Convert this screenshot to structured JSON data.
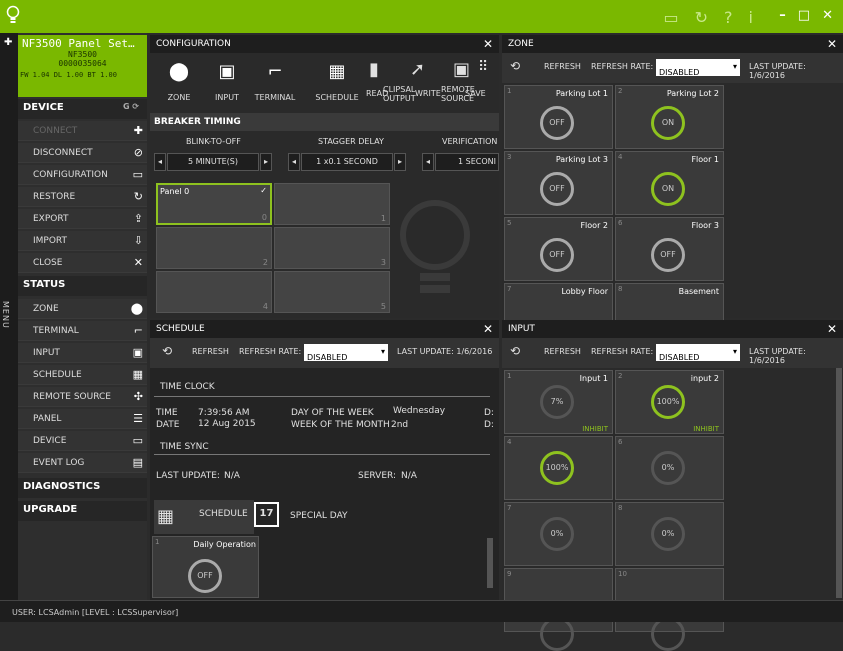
{
  "app": {
    "user_status": "USER: LCSAdmin [LEVEL : LCSSupervisor]"
  },
  "lcd": {
    "line1": "NF3500 Panel Set…",
    "line2": "NF3500",
    "line3": "0000035064",
    "line4": "FW 1.04  DL 1.00  BT 1.00"
  },
  "nav": {
    "device_label": "DEVICE",
    "device_items": [
      "CONNECT",
      "DISCONNECT",
      "CONFIGURATION",
      "RESTORE",
      "EXPORT",
      "IMPORT",
      "CLOSE"
    ],
    "status_label": "STATUS",
    "status_items": [
      "ZONE",
      "TERMINAL",
      "INPUT",
      "SCHEDULE",
      "REMOTE SOURCE",
      "PANEL",
      "DEVICE",
      "EVENT LOG"
    ],
    "diagnostics_label": "DIAGNOSTICS",
    "upgrade_label": "UPGRADE",
    "menu_label": "MENU"
  },
  "config": {
    "title": "CONFIGURATION",
    "tools": [
      "ZONE",
      "INPUT",
      "TERMINAL",
      "SCHEDULE"
    ],
    "tools2": [
      "CLIPSAL OUTPUT",
      "WRITE",
      "REMOTE SOURCE",
      "READ",
      "SAVE"
    ],
    "breaker_timing": "BREAKER TIMING",
    "blink_label": "BLINK-TO-OFF",
    "stagger_label": "STAGGER DELAY",
    "verification_label": "VERIFICATION",
    "blink_value": "5 MINUTE(S)",
    "stagger_value": "1 x0.1 SECOND",
    "verification_value": "1 SECONI",
    "panel_name": "Panel 0",
    "tile_nums": [
      "0",
      "1",
      "2",
      "3",
      "4",
      "5"
    ]
  },
  "zone": {
    "title": "ZONE",
    "refresh": "REFRESH",
    "refresh_rate_label": "REFRESH RATE:",
    "refresh_rate": "DISABLED",
    "last_update": "LAST UPDATE: 1/6/2016",
    "tiles": [
      {
        "idx": "1",
        "name": "Parking Lot 1",
        "state": "OFF"
      },
      {
        "idx": "2",
        "name": "Parking Lot 2",
        "state": "ON"
      },
      {
        "idx": "3",
        "name": "Parking Lot 3",
        "state": "OFF"
      },
      {
        "idx": "4",
        "name": "Floor 1",
        "state": "ON"
      },
      {
        "idx": "5",
        "name": "Floor 2",
        "state": "OFF"
      },
      {
        "idx": "6",
        "name": "Floor 3",
        "state": "OFF"
      },
      {
        "idx": "7",
        "name": "Lobby Floor",
        "state": ""
      },
      {
        "idx": "8",
        "name": "Basement",
        "state": ""
      }
    ]
  },
  "schedule": {
    "title": "SCHEDULE",
    "refresh": "REFRESH",
    "refresh_rate_label": "REFRESH RATE:",
    "refresh_rate": "DISABLED",
    "last_update": "LAST UPDATE: 1/6/2016",
    "time_clock": "TIME CLOCK",
    "time_label": "TIME",
    "time_value": "7:39:56 AM",
    "date_label": "DATE",
    "date_value": "12 Aug 2015",
    "dow_label": "DAY OF THE WEEK",
    "dow_value": "Wednesday",
    "wom_label": "WEEK OF THE MONTH",
    "wom_value": "2nd",
    "d_label1": "D:",
    "d_label2": "D:",
    "time_sync": "TIME SYNC",
    "last_update_sync": "LAST UPDATE:",
    "last_update_sync_value": "N/A",
    "server_label": "SERVER:",
    "server_value": "N/A",
    "schedule_tab": "SCHEDULE",
    "special_day_tab": "SPECIAL DAY",
    "special_day_icon": "17",
    "tile_idx": "1",
    "tile_name": "Daily Operation",
    "tile_state": "OFF"
  },
  "input": {
    "title": "INPUT",
    "refresh": "REFRESH",
    "refresh_rate_label": "REFRESH RATE:",
    "refresh_rate": "DISABLED",
    "last_update": "LAST UPDATE: 1/6/2016",
    "tiles": [
      {
        "idx": "1",
        "name": "Input 1",
        "value": "7%",
        "badge": "INHIBIT"
      },
      {
        "idx": "2",
        "name": "input 2",
        "value": "100%",
        "badge": "INHIBIT"
      },
      {
        "idx": "4",
        "name": "",
        "value": "100%",
        "badge": ""
      },
      {
        "idx": "6",
        "name": "",
        "value": "0%",
        "badge": ""
      },
      {
        "idx": "7",
        "name": "",
        "value": "0%",
        "badge": ""
      },
      {
        "idx": "8",
        "name": "",
        "value": "0%",
        "badge": ""
      },
      {
        "idx": "9",
        "name": "",
        "value": "",
        "badge": ""
      },
      {
        "idx": "10",
        "name": "",
        "value": "",
        "badge": ""
      }
    ]
  },
  "colors": {
    "accent": "#7ab800",
    "ring_on": "#8ec21f"
  }
}
